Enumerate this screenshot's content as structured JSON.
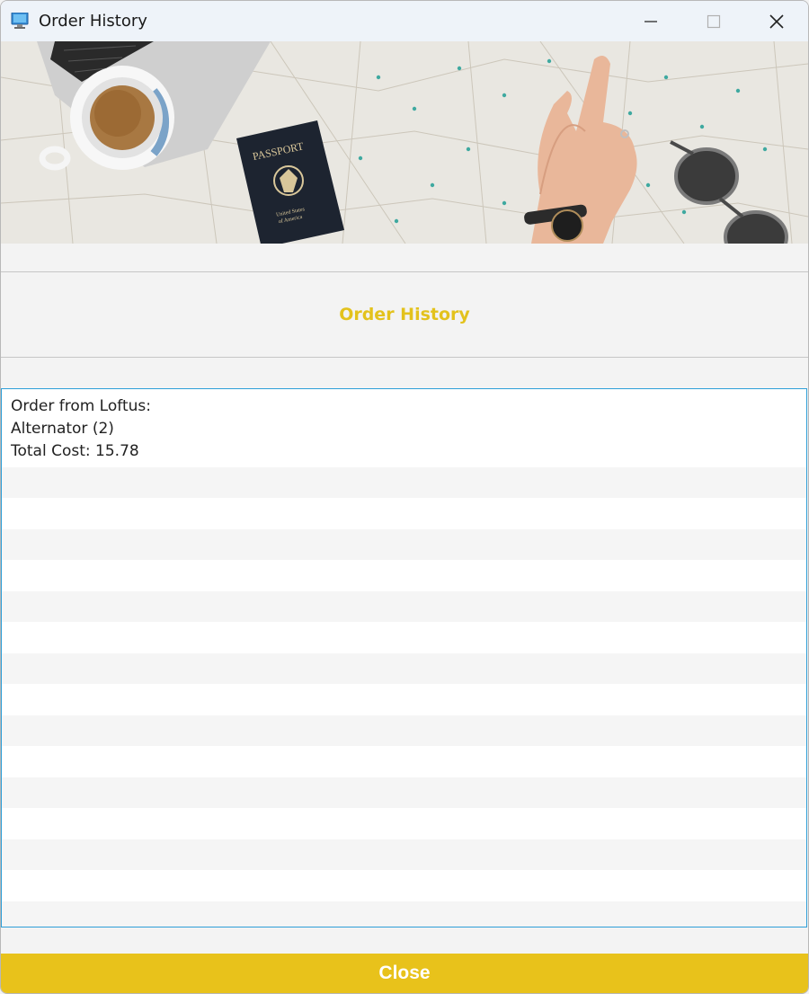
{
  "window": {
    "title": "Order History",
    "icon": "computer-monitor-icon"
  },
  "window_controls": {
    "minimize_icon": "minimize-icon",
    "maximize_icon": "maximize-icon",
    "close_icon": "close-icon"
  },
  "banner": {
    "passport_text": "PASSPORT",
    "passport_sub": [
      "United States",
      "of America"
    ]
  },
  "heading": {
    "title": "Order History",
    "color": "#e3c21c"
  },
  "orders": {
    "lines": [
      "Order from Loftus:",
      "Alternator (2)",
      "Total Cost: 15.78"
    ]
  },
  "footer": {
    "close_label": "Close",
    "button_color": "#e8c21b"
  }
}
